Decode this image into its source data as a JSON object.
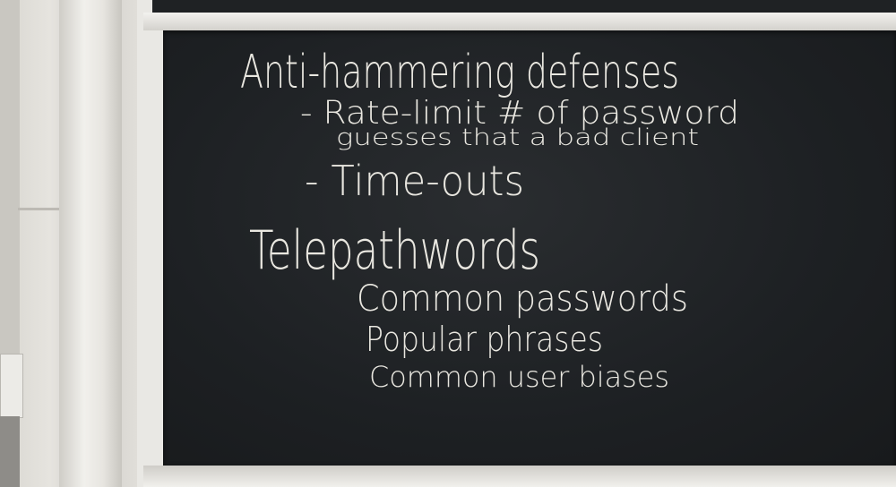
{
  "board": {
    "lines": [
      "Anti-hammering defenses",
      "- Rate-limit # of password",
      "guesses that a bad client",
      "- Time-outs",
      "Telepathwords",
      "Common passwords",
      "Popular phrases",
      "Common user biases"
    ]
  }
}
